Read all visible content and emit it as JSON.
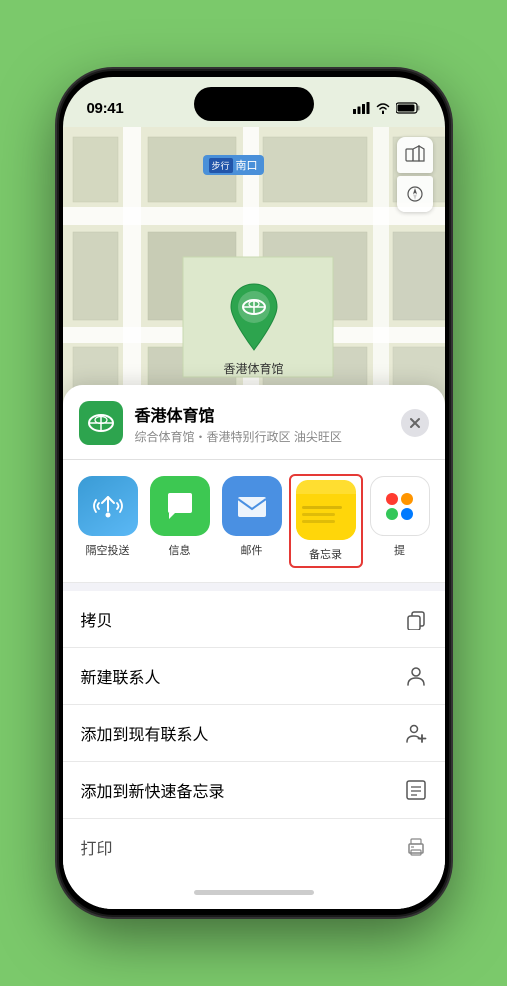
{
  "status_bar": {
    "time": "09:41",
    "signal_bars": "▌▌▌",
    "wifi": "wifi",
    "battery": "battery"
  },
  "map": {
    "label_text": "南口",
    "label_prefix": "步行",
    "pin_label": "香港体育馆",
    "map_type_icon": "🗺",
    "compass_icon": "⊕"
  },
  "location_card": {
    "name": "香港体育馆",
    "subtitle": "综合体育馆・香港特别行政区 油尖旺区",
    "close_label": "×"
  },
  "share_items": [
    {
      "id": "airdrop",
      "label": "隔空投送",
      "type": "airdrop"
    },
    {
      "id": "messages",
      "label": "信息",
      "type": "messages"
    },
    {
      "id": "mail",
      "label": "邮件",
      "type": "mail"
    },
    {
      "id": "notes",
      "label": "备忘录",
      "type": "notes"
    },
    {
      "id": "more",
      "label": "提",
      "type": "more"
    }
  ],
  "actions": [
    {
      "id": "copy",
      "label": "拷贝",
      "icon": "copy"
    },
    {
      "id": "new-contact",
      "label": "新建联系人",
      "icon": "person"
    },
    {
      "id": "add-existing",
      "label": "添加到现有联系人",
      "icon": "person-add"
    },
    {
      "id": "quick-note",
      "label": "添加到新快速备忘录",
      "icon": "note"
    },
    {
      "id": "print",
      "label": "打印",
      "icon": "print"
    }
  ]
}
